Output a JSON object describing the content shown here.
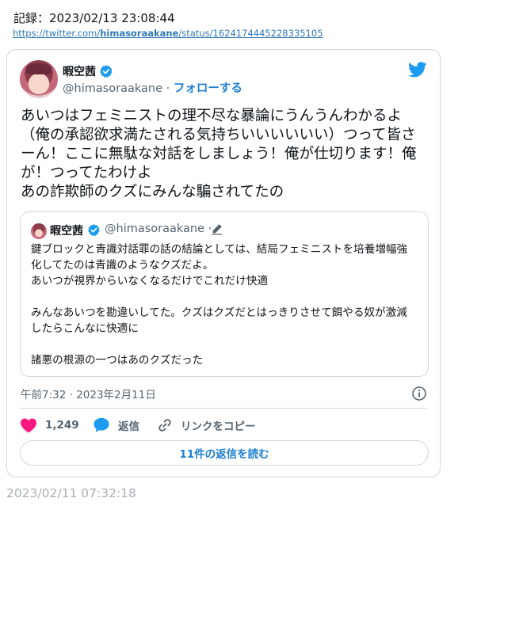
{
  "record": {
    "label": "記録：",
    "datetime": "2023/02/13 23:08:44"
  },
  "source": {
    "url_prefix": "https://twitter.com/",
    "url_user": "himasoraakane",
    "url_suffix": "/status/1624174445228335105"
  },
  "tweet": {
    "display_name": "暇空茜",
    "handle": "@himasoraakane",
    "separator": "·",
    "follow_label": "フォローする",
    "text": "あいつはフェミニストの理不尽な暴論にうんうんわかるよ（俺の承認欲求満たされる気持ちいいいいいい）つって皆さーん！ここに無駄な対話をしましょう！俺が仕切ります！俺が！つってたわけよ\nあの詐欺師のクズにみんな騙されてたの",
    "timestamp": "午前7:32 · 2023年2月11日",
    "like_count": "1,249",
    "reply_label": "返信",
    "copy_link_label": "リンクをコピー",
    "read_replies_label": "11件の返信を読む"
  },
  "quote": {
    "display_name": "暇空茜",
    "handle": "@himasoraakane",
    "separator": "·",
    "text": "鍵ブロックと青識対話罪の話の結論としては、結局フェミニストを培養増幅強化してたのは青識のようなクズだよ。\nあいつが視界からいなくなるだけでこれだけ快適\n\nみんなあいつを勘違いしてた。クズはクズだとはっきりさせて餌やる奴が激減したらこんなに快適に\n\n諸悪の根源の一つはあのクズだった"
  },
  "capture_time": "2023/02/11 07:32:18",
  "icons": {
    "verified": "verified-badge-icon",
    "twitter": "twitter-bird-icon",
    "edit": "pencil-edit-icon",
    "info": "info-icon",
    "like": "heart-icon",
    "reply": "speech-bubble-icon",
    "copy": "link-icon"
  },
  "colors": {
    "accent": "#1d9bf0",
    "like": "#f91880",
    "link": "#1d7fd1",
    "muted": "#536471",
    "border": "#cfd9de"
  }
}
